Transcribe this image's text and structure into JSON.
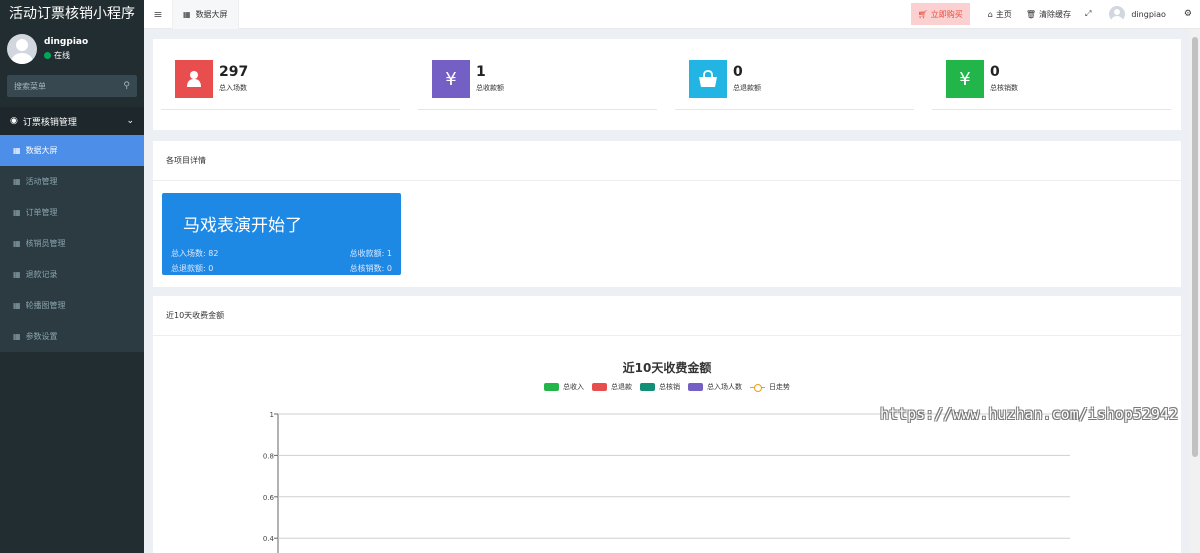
{
  "app": {
    "title": "活动订票核销小程序"
  },
  "user": {
    "name": "dingpiao",
    "status": "在线"
  },
  "search": {
    "placeholder": "搜索菜单"
  },
  "menu": {
    "group": "订票核销管理",
    "items": [
      {
        "label": "数据大屏",
        "active": true
      },
      {
        "label": "活动管理"
      },
      {
        "label": "订单管理"
      },
      {
        "label": "核销员管理"
      },
      {
        "label": "退款记录"
      },
      {
        "label": "轮播图管理"
      },
      {
        "label": "参数设置"
      }
    ]
  },
  "header": {
    "tab": "数据大屏",
    "buy": "立即购买",
    "home": "主页",
    "clear_cache": "清除缓存",
    "user": "dingpiao"
  },
  "stats": [
    {
      "value": "297",
      "label": "总入场数",
      "color": "#e84e4e",
      "icon": "user-icon"
    },
    {
      "value": "1",
      "label": "总收款额",
      "color": "#7460c4",
      "icon": "yen-icon"
    },
    {
      "value": "0",
      "label": "总退款额",
      "color": "#22b5e3",
      "icon": "shopping-bag-icon"
    },
    {
      "value": "0",
      "label": "总核销数",
      "color": "#22b549",
      "icon": "yen-icon"
    }
  ],
  "projects": {
    "heading": "各项目详情",
    "card": {
      "title": "马戏表演开始了",
      "entries_label": "总入场数: 82",
      "income_label": "总收款额: 1",
      "refund_label": "总退款额: 0",
      "verify_label": "总核销数: 0",
      "color": "#1e88e5"
    }
  },
  "income_panel": {
    "heading": "近10天收费金额"
  },
  "chart_data": {
    "type": "bar",
    "title": "近10天收费金额",
    "series": [
      {
        "name": "总收入",
        "color": "#22b549",
        "values": []
      },
      {
        "name": "总退款",
        "color": "#e84e4e",
        "values": []
      },
      {
        "name": "总核销",
        "color": "#128f76",
        "values": []
      },
      {
        "name": "总入场人数",
        "color": "#7460c4",
        "values": []
      },
      {
        "name": "日走势",
        "color": "#f39c12",
        "type": "line",
        "values": []
      }
    ],
    "yticks": [
      "1",
      "0.8",
      "0.6",
      "0.4"
    ],
    "ylim": [
      0,
      1
    ],
    "grid": true,
    "legend_position": "top-center"
  },
  "watermark": {
    "text": "https://www.huzhan.com/ishop52942"
  }
}
